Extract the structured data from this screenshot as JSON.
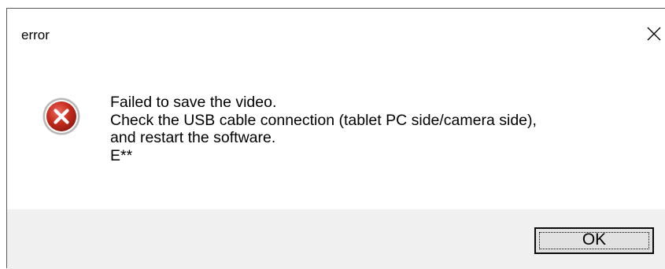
{
  "window": {
    "title": "error",
    "close_icon": "close-icon"
  },
  "content": {
    "icon": "error-icon",
    "icon_color": "#c42b1c",
    "lines": [
      "Failed to save the video.",
      "Check the USB cable connection (tablet PC side/camera side),",
      "and restart the software.",
      "E**"
    ]
  },
  "buttons": {
    "ok_label": "OK"
  }
}
